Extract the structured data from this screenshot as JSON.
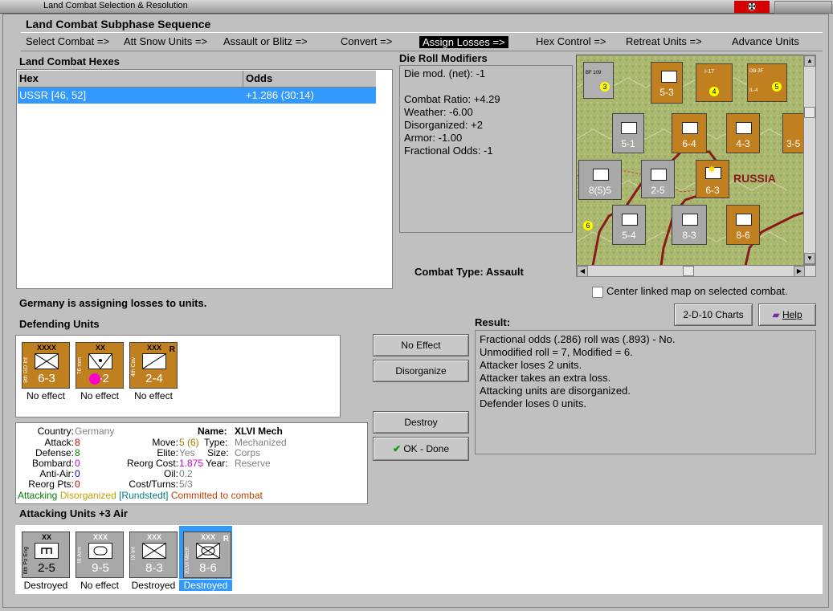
{
  "window": {
    "title": "Land Combat Selection & Resolution"
  },
  "subphase": {
    "title": "Land Combat Subphase Sequence",
    "steps": [
      "Select Combat =>",
      "Att Snow Units =>",
      "Assault or Blitz =>",
      "Convert =>",
      "Assign Losses =>",
      "Hex Control =>",
      "Retreat Units =>",
      "Advance Units"
    ],
    "active_index": 4
  },
  "hexes": {
    "title": "Land Combat Hexes",
    "columns": [
      "Hex",
      "Odds"
    ],
    "rows": [
      {
        "hex": "USSR [46, 52]",
        "odds": "+1.286 (30:14)"
      }
    ]
  },
  "modifiers": {
    "title": "Die Roll Modifiers",
    "lines": [
      "Die mod. (net): -1",
      "",
      "Combat Ratio: +4.29",
      "Weather: -6.00",
      "Disorganized: +2",
      "Armor: -1.00",
      "Fractional Odds: -1"
    ]
  },
  "combat_type": {
    "label": "Combat Type:",
    "value": "Assault"
  },
  "map": {
    "region_label": "RUSSIA",
    "counters": [
      "5-3",
      "4",
      "5",
      "3",
      "5-1",
      "6-4",
      "4-3",
      "3-5",
      "8(5)5",
      "2-5",
      "6-3",
      "5-4",
      "8-3",
      "8-6",
      "6"
    ],
    "air_units": [
      "BF 109",
      "I-17",
      "DB-3F",
      "IL-4"
    ]
  },
  "center_map": {
    "label": "Center linked map on selected combat."
  },
  "status": "Germany is assigning losses to units.",
  "buttons": {
    "charts": "2-D-10 Charts",
    "help": "Help",
    "no_effect": "No Effect",
    "disorganize": "Disorganize",
    "destroy": "Destroy",
    "ok_done": "OK - Done"
  },
  "defending": {
    "title": "Defending Units",
    "units": [
      {
        "name": "9th GD Inf",
        "size": "XXXX",
        "stat": "6-3",
        "status": "No effect",
        "color": "#c08020"
      },
      {
        "name": "76 mm",
        "size": "XX",
        "stat": "3-2",
        "status": "No effect",
        "color": "#c08020"
      },
      {
        "name": "4th Cav",
        "size": "XXX",
        "stat": "2-4",
        "status": "No effect",
        "color": "#c08020"
      }
    ]
  },
  "unit_info": {
    "country_label": "Country:",
    "country": "Germany",
    "attack_label": "Attack:",
    "attack": "8",
    "defense_label": "Defense:",
    "defense": "8",
    "bombard_label": "Bombard:",
    "bombard": "0",
    "antiair_label": "Anti-Air:",
    "antiair": "0",
    "reorg_label": "Reorg Pts:",
    "reorg": "0",
    "name_label": "Name:",
    "name": "XLVI Mech",
    "move_label": "Move:",
    "move": "5 (6)",
    "type_label": "Type:",
    "type": "Mechanized",
    "elite_label": "Elite:",
    "elite": "Yes",
    "size_label": "Size:",
    "size": "Corps",
    "reorg_cost_label": "Reorg Cost:",
    "reorg_cost": "1.875",
    "year_label": "Year:",
    "year": "Reserve",
    "oil_label": "Oil:",
    "oil": "0.2",
    "cost_label": "Cost/Turns:",
    "cost": "5/3",
    "status_attacking": "Attacking",
    "status_disorganized": "Disorganized",
    "status_hq": "[Rundstedt]",
    "status_committed": "Committed to combat"
  },
  "result": {
    "title": "Result:",
    "lines": [
      "Fractional odds (.286) roll was (.893)  - No.",
      "Unmodified roll = 7, Modified = 6.",
      "Attacker loses 2 units.",
      "Attacker takes an extra loss.",
      "Attacking units are disorganized.",
      "Defender loses 0 units."
    ]
  },
  "attacking": {
    "title": "Attacking Units +3 Air",
    "units": [
      {
        "name": "6th Pz Eng",
        "size": "XX",
        "stat": "2-5",
        "status": "Destroyed"
      },
      {
        "name": "III Arm",
        "size": "XXX",
        "stat": "9-5",
        "status": "No effect"
      },
      {
        "name": "IX Inf",
        "size": "XXX",
        "stat": "8-3",
        "status": "Destroyed"
      },
      {
        "name": "XLVI Mech",
        "size": "XXX",
        "stat": "8-6",
        "status": "Destroyed",
        "selected": true
      }
    ]
  },
  "colors": {
    "selection": "#3399ff",
    "axis_counter": "#a8a8a8",
    "soviet_counter": "#c08020",
    "attack_value": "#cc0000",
    "defense_value": "#008000",
    "bombard_value": "#cc00cc",
    "antiair_value": "#0000cc"
  }
}
